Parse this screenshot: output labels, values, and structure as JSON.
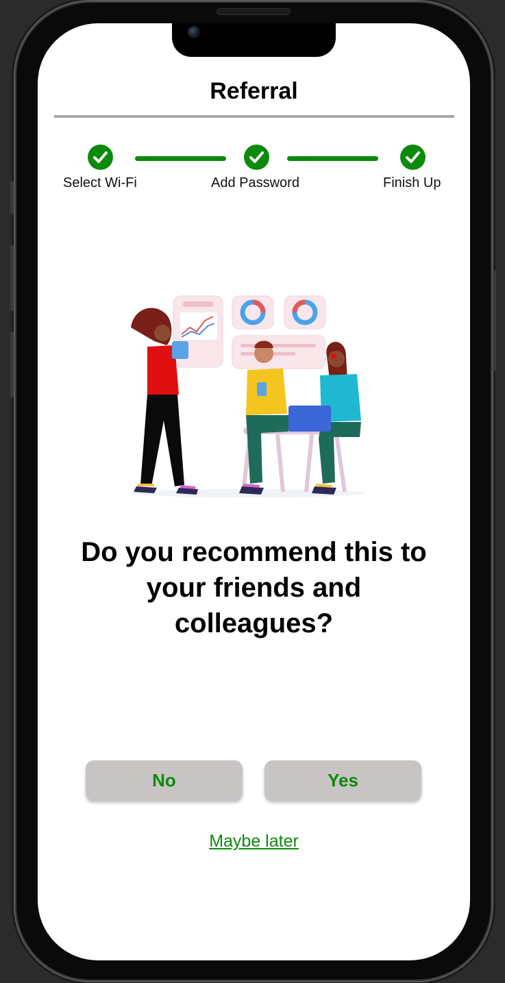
{
  "header": {
    "title": "Referral"
  },
  "stepper": {
    "steps": [
      {
        "label": "Select Wi-Fi",
        "status": "complete"
      },
      {
        "label": "Add Password",
        "status": "complete"
      },
      {
        "label": "Finish Up",
        "status": "complete"
      }
    ],
    "icon": "check-icon"
  },
  "prompt": {
    "question": "Do you recommend this to your friends and colleagues?"
  },
  "actions": {
    "no_label": "No",
    "yes_label": "Yes",
    "later_label": "Maybe later"
  },
  "colors": {
    "accent": "#0c8a0c",
    "button_bg": "#c8c4c3",
    "divider": "#a7a7a7"
  }
}
